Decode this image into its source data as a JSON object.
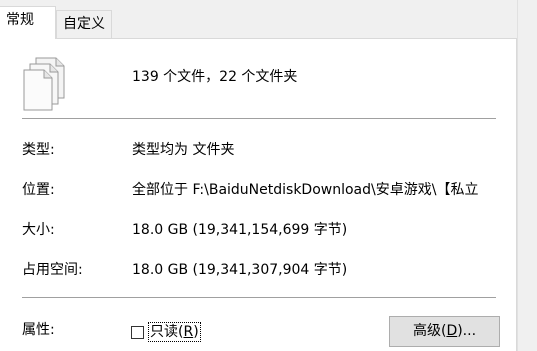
{
  "tabs": {
    "general": "常规",
    "custom": "自定义"
  },
  "summary": "139 个文件，22 个文件夹",
  "rows": {
    "type": {
      "label": "类型:",
      "value": "类型均为 文件夹"
    },
    "location": {
      "label": "位置:",
      "value": "全部位于 F:\\BaiduNetdiskDownload\\安卓游戏\\【私立"
    },
    "size": {
      "label": "大小:",
      "value": "18.0 GB (19,341,154,699 字节)"
    },
    "size_on_disk": {
      "label": "占用空间:",
      "value": "18.0 GB (19,341,307,904 字节)"
    },
    "attributes": {
      "label": "属性:"
    }
  },
  "readonly": {
    "text": "只读(",
    "mnemonic": "R",
    "close": ")",
    "checked": false
  },
  "advanced_button": {
    "text": "高级(",
    "mnemonic": "D",
    "close": ")..."
  },
  "icons": {
    "files": "multiple-files-icon"
  }
}
